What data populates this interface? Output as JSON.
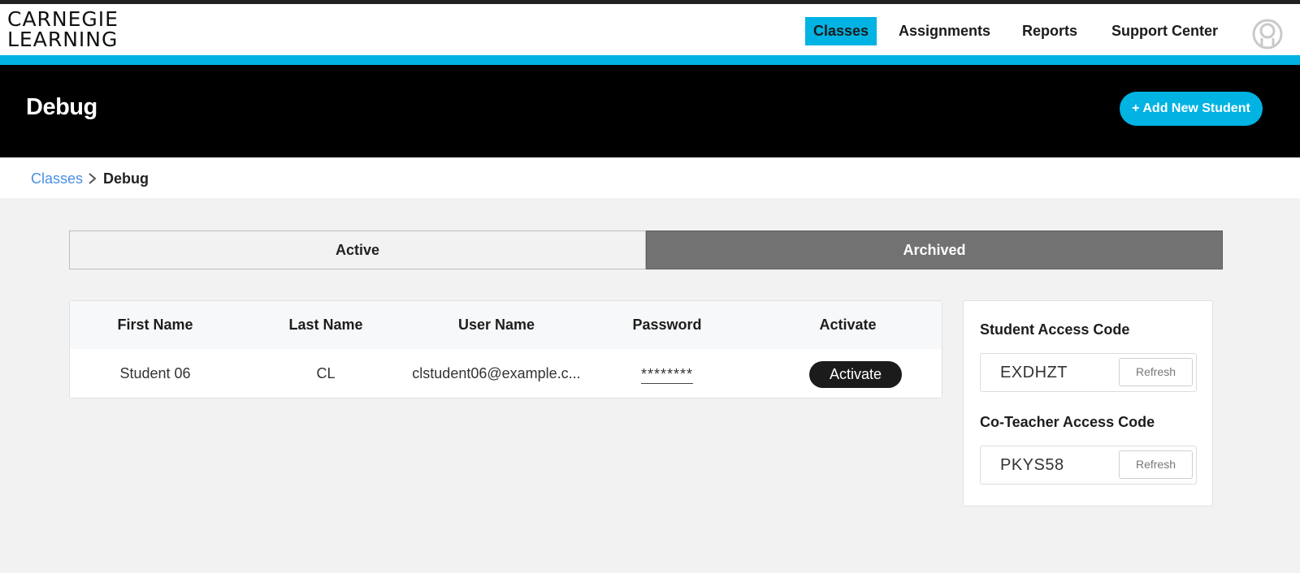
{
  "logo": {
    "line1": "CARNEGIE",
    "line2": "LEARNING"
  },
  "nav": {
    "classes": "Classes",
    "assignments": "Assignments",
    "reports": "Reports",
    "support": "Support Center",
    "active_color": "#00b3e3"
  },
  "header": {
    "title": "Debug",
    "add_student": "+ Add New Student"
  },
  "breadcrumb": {
    "parent": "Classes",
    "current": "Debug"
  },
  "tabs": {
    "active": "Active",
    "archived": "Archived"
  },
  "table": {
    "columns": [
      "First Name",
      "Last Name",
      "User Name",
      "Password",
      "Activate"
    ],
    "rows": [
      {
        "first_name": "Student 06",
        "last_name": "CL",
        "user_name": "clstudent06@example.c...",
        "password": "********",
        "action": "Activate"
      }
    ]
  },
  "access_codes": {
    "student_label": "Student Access Code",
    "student_code": "EXDHZT",
    "coteacher_label": "Co-Teacher Access Code",
    "coteacher_code": "PKYS58",
    "refresh_label": "Refresh"
  },
  "icons": {
    "avatar": "user-avatar-icon",
    "breadcrumb_separator": "chevron-right-icon"
  }
}
